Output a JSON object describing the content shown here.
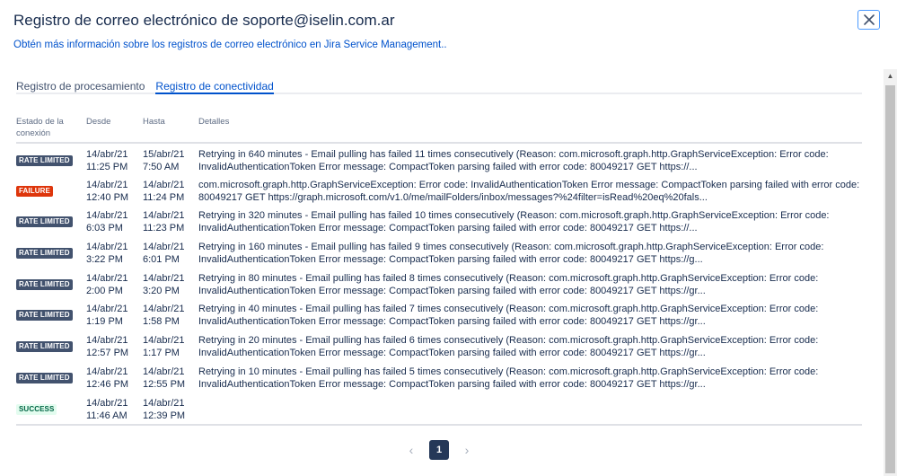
{
  "modal": {
    "title": "Registro de correo electrónico de soporte@iselin.com.ar",
    "subtitle": "Obtén más información sobre los registros de correo electrónico en Jira Service Management.."
  },
  "tabs": [
    {
      "label": "Registro de procesamiento",
      "active": false
    },
    {
      "label": "Registro de conectividad",
      "active": true
    }
  ],
  "table": {
    "headers": {
      "status": "Estado de la conexión",
      "from": "Desde",
      "to": "Hasta",
      "details": "Detalles"
    },
    "rows": [
      {
        "status": "RATE LIMITED",
        "kind": "rate",
        "from_date": "14/abr/21",
        "from_time": "11:25 PM",
        "to_date": "15/abr/21",
        "to_time": "7:50 AM",
        "d1": "Retrying in 640 minutes - Email pulling has failed 11 times consecutively (Reason: com.microsoft.graph.http.GraphServiceException: Error code:",
        "d2": "InvalidAuthenticationToken Error message: CompactToken parsing failed with error code: 80049217 GET https://..."
      },
      {
        "status": "FAILURE",
        "kind": "fail",
        "from_date": "14/abr/21",
        "from_time": "12:40 PM",
        "to_date": "14/abr/21",
        "to_time": "11:24 PM",
        "d1": "com.microsoft.graph.http.GraphServiceException: Error code: InvalidAuthenticationToken Error message: CompactToken parsing failed with error code:",
        "d2": "80049217 GET https://graph.microsoft.com/v1.0/me/mailFolders/inbox/messages?%24filter=isRead%20eq%20fals..."
      },
      {
        "status": "RATE LIMITED",
        "kind": "rate",
        "from_date": "14/abr/21",
        "from_time": "6:03 PM",
        "to_date": "14/abr/21",
        "to_time": "11:23 PM",
        "d1": "Retrying in 320 minutes - Email pulling has failed 10 times consecutively (Reason: com.microsoft.graph.http.GraphServiceException: Error code:",
        "d2": "InvalidAuthenticationToken Error message: CompactToken parsing failed with error code: 80049217 GET https://..."
      },
      {
        "status": "RATE LIMITED",
        "kind": "rate",
        "from_date": "14/abr/21",
        "from_time": "3:22 PM",
        "to_date": "14/abr/21",
        "to_time": "6:01 PM",
        "d1": "Retrying in 160 minutes - Email pulling has failed 9 times consecutively (Reason: com.microsoft.graph.http.GraphServiceException: Error code:",
        "d2": "InvalidAuthenticationToken Error message: CompactToken parsing failed with error code: 80049217 GET https://g..."
      },
      {
        "status": "RATE LIMITED",
        "kind": "rate",
        "from_date": "14/abr/21",
        "from_time": "2:00 PM",
        "to_date": "14/abr/21",
        "to_time": "3:20 PM",
        "d1": "Retrying in 80 minutes - Email pulling has failed 8 times consecutively (Reason: com.microsoft.graph.http.GraphServiceException: Error code:",
        "d2": "InvalidAuthenticationToken Error message: CompactToken parsing failed with error code: 80049217 GET https://gr..."
      },
      {
        "status": "RATE LIMITED",
        "kind": "rate",
        "from_date": "14/abr/21",
        "from_time": "1:19 PM",
        "to_date": "14/abr/21",
        "to_time": "1:58 PM",
        "d1": "Retrying in 40 minutes - Email pulling has failed 7 times consecutively (Reason: com.microsoft.graph.http.GraphServiceException: Error code:",
        "d2": "InvalidAuthenticationToken Error message: CompactToken parsing failed with error code: 80049217 GET https://gr..."
      },
      {
        "status": "RATE LIMITED",
        "kind": "rate",
        "from_date": "14/abr/21",
        "from_time": "12:57 PM",
        "to_date": "14/abr/21",
        "to_time": "1:17 PM",
        "d1": "Retrying in 20 minutes - Email pulling has failed 6 times consecutively (Reason: com.microsoft.graph.http.GraphServiceException: Error code:",
        "d2": "InvalidAuthenticationToken Error message: CompactToken parsing failed with error code: 80049217 GET https://gr..."
      },
      {
        "status": "RATE LIMITED",
        "kind": "rate",
        "from_date": "14/abr/21",
        "from_time": "12:46 PM",
        "to_date": "14/abr/21",
        "to_time": "12:55 PM",
        "d1": "Retrying in 10 minutes - Email pulling has failed 5 times consecutively (Reason: com.microsoft.graph.http.GraphServiceException: Error code:",
        "d2": "InvalidAuthenticationToken Error message: CompactToken parsing failed with error code: 80049217 GET https://gr..."
      },
      {
        "status": "SUCCESS",
        "kind": "success",
        "from_date": "14/abr/21",
        "from_time": "11:46 AM",
        "to_date": "14/abr/21",
        "to_time": "12:39 PM",
        "d1": "",
        "d2": ""
      }
    ]
  },
  "pagination": {
    "prev": "‹",
    "current": "1",
    "next": "›"
  },
  "icons": {
    "close": "close-icon",
    "prev": "chevron-left-icon",
    "next": "chevron-right-icon"
  },
  "colors": {
    "rate_limited": "#42526e",
    "failure": "#de350b",
    "success_bg": "#e3fcef",
    "success_text": "#006644",
    "link": "#0052cc"
  }
}
